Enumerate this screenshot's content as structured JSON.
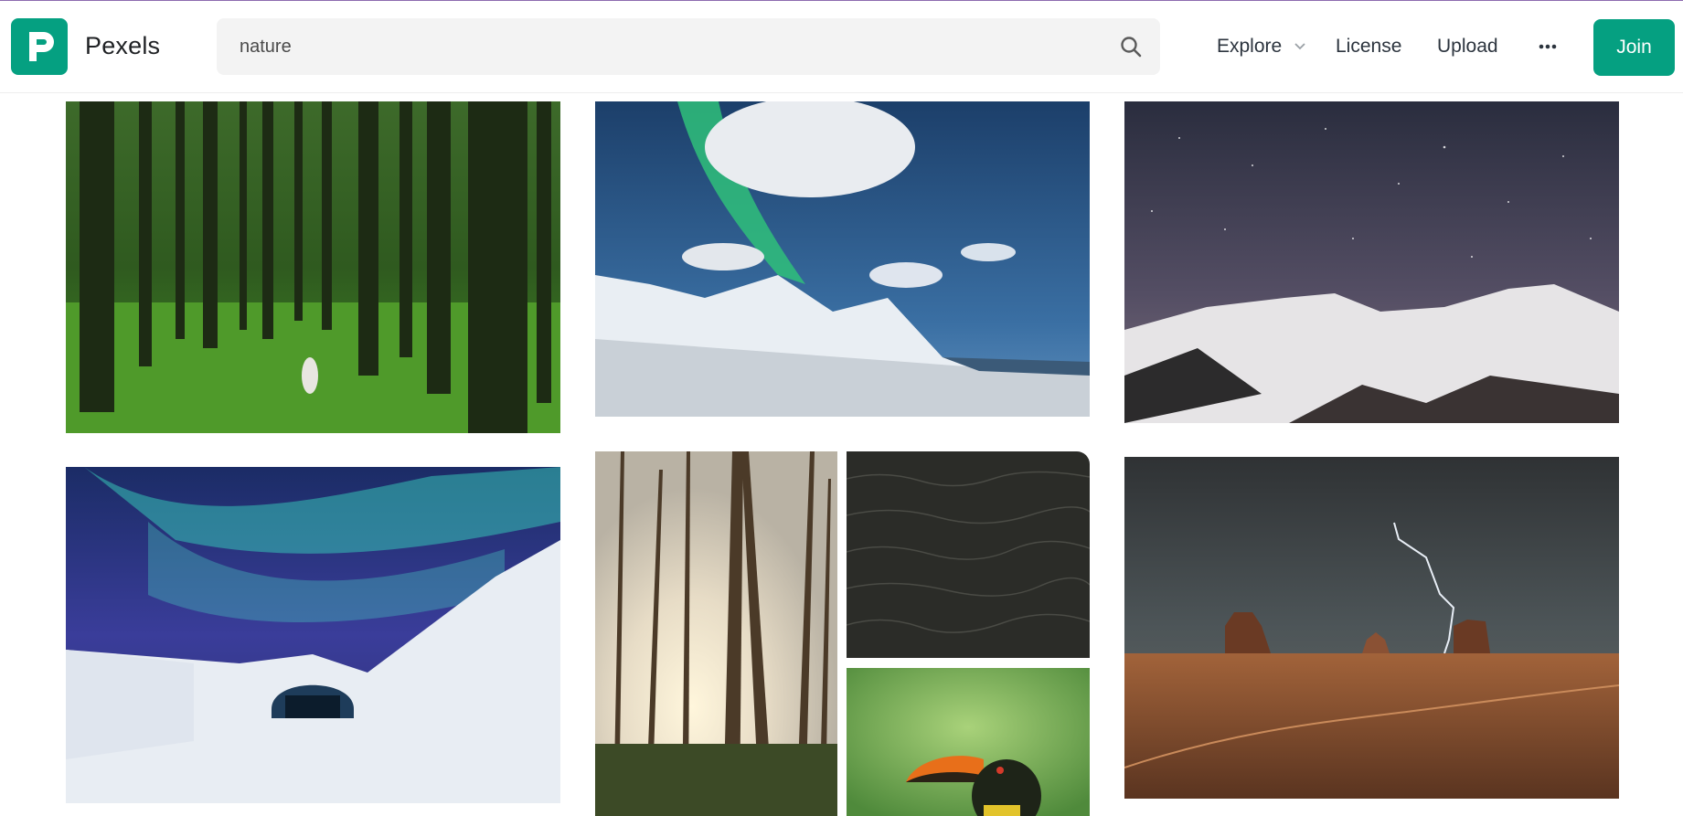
{
  "brand": {
    "name": "Pexels",
    "logo_icon": "pexels-logo-icon",
    "accent": "#05a081"
  },
  "search": {
    "value": "nature",
    "placeholder": "Search for free photos",
    "icon": "search-icon"
  },
  "nav": {
    "explore": "Explore",
    "license": "License",
    "upload": "Upload",
    "more_icon": "more-dots-icon",
    "join": "Join"
  },
  "photos": [
    {
      "subject": "pine-forest-with-person"
    },
    {
      "subject": "aurora-over-snowy-coast"
    },
    {
      "subject": "starry-sky-over-snowy-mountains"
    },
    {
      "subject": "aurora-over-ice-hotel"
    },
    {
      "subject": "sunlit-forest"
    },
    {
      "subject": "dark-sea-water"
    },
    {
      "subject": "toucan-bird"
    },
    {
      "subject": "desert-buttes-with-lightning"
    }
  ]
}
